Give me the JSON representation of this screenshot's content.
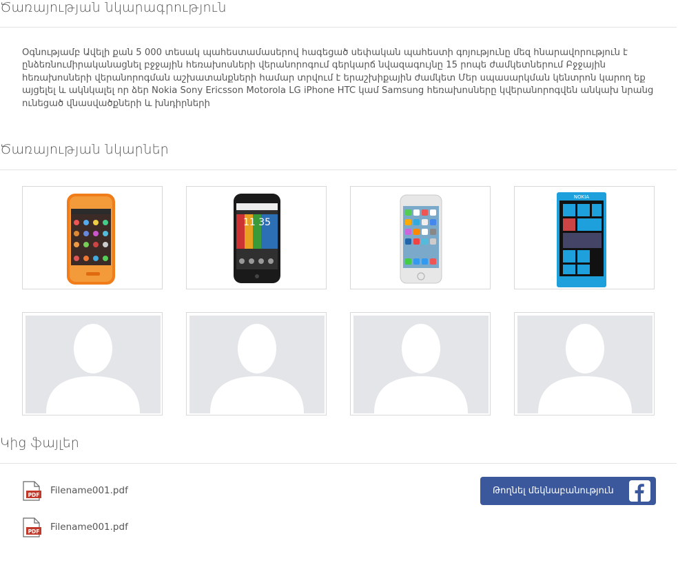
{
  "sections": {
    "description_title": "Ծառայության նկարագրություն",
    "description_text": "Օգնությամբ Ավելի քան 5 000 տեսակ պահեստամասերով հագեցած սեփական պահեստի գոյությունը մեզ հնարավորություն է ընձեռնումիրականացնել բջջային հեռախոսների վերանորոգում գերկարճ նվազագույնը 15 րոպե ժամկետներում Բջջային հեռախոսների վերանորոգման աշխատանքների համար տրվում է երաշխիքային ժամկետ Մեր սպասարկման կենտրոն կարող եք այցելել և ակնկալել որ ձեր Nokia Sony Ericsson Motorola LG iPhone HTC կամ Samsung հեռախոսները կվերանորոգվեն անկախ նրանց ունեցած վնասվածքների և խնդիրների",
    "images_title": "Ծառայության նկարներ",
    "files_title": "Կից ֆայլեր"
  },
  "gallery": {
    "phones": [
      {
        "icon": "zte-phone-image",
        "color": "#f07d1a"
      },
      {
        "icon": "moto-phone-image",
        "color": "#1a1a1a"
      },
      {
        "icon": "iphone-image",
        "color": "#e9e9e9"
      },
      {
        "icon": "nokia-lumia-image",
        "color": "#1ea0dc"
      }
    ],
    "placeholders": 4
  },
  "files": [
    {
      "name": "Filename001.pdf",
      "icon": "pdf-icon",
      "badge": "PDF"
    },
    {
      "name": "Filename001.pdf",
      "icon": "pdf-icon",
      "badge": "PDF"
    }
  ],
  "facebook_button": {
    "label": "Թողնել մեկնաբանություն",
    "icon": "facebook-icon",
    "bg_color": "#3a589b"
  }
}
